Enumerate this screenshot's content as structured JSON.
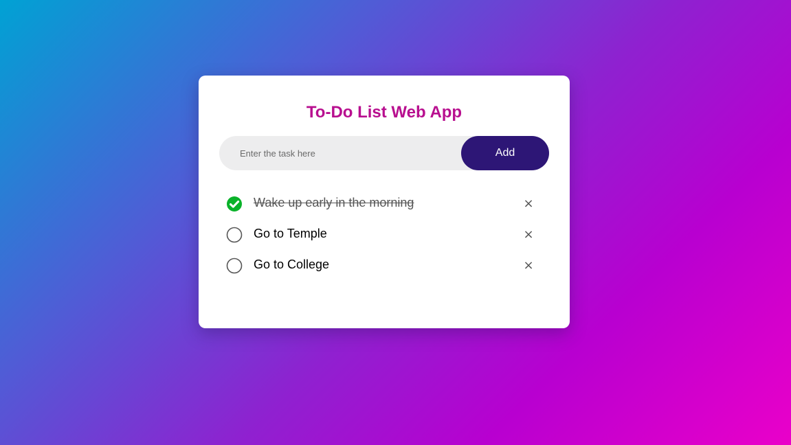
{
  "app": {
    "title": "To-Do List Web App"
  },
  "input": {
    "placeholder": "Enter the task here",
    "value": "",
    "add_label": "Add"
  },
  "tasks": [
    {
      "text": "Wake up early in the morning",
      "done": true,
      "delete_icon": "×"
    },
    {
      "text": "Go to Temple",
      "done": false,
      "delete_icon": "×"
    },
    {
      "text": "Go to College",
      "done": false,
      "delete_icon": "×"
    }
  ],
  "icons": {
    "checked": "checked-circle-icon",
    "unchecked": "unchecked-circle-icon",
    "delete": "close-icon"
  },
  "colors": {
    "title": "#b80f8f",
    "add_button": "#2d1676",
    "checked": "#0ab22a",
    "input_bg": "#ededee"
  }
}
